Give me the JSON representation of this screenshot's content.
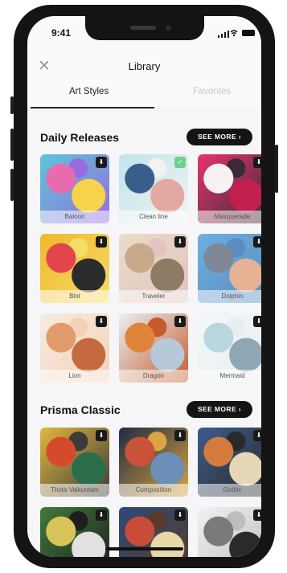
{
  "status": {
    "time": "9:41"
  },
  "header": {
    "title": "Library",
    "close_icon": "close-icon"
  },
  "tabs": [
    {
      "label": "Art Styles",
      "active": true
    },
    {
      "label": "Favorites",
      "active": false
    }
  ],
  "sections": [
    {
      "title": "Daily Releases",
      "see_more": "SEE MORE",
      "items": [
        {
          "label": "Baloon",
          "badge": "download",
          "colors": [
            "#59c7d6",
            "#e86bb0",
            "#f7d24b",
            "#9a6be0"
          ]
        },
        {
          "label": "Clean line",
          "badge": "check",
          "colors": [
            "#bfe5ea",
            "#3a5e8a",
            "#e4a8a2",
            "#f2f2f2"
          ]
        },
        {
          "label": "Masquerade",
          "badge": "download",
          "colors": [
            "#e7356c",
            "#f8f1f3",
            "#c11f4e",
            "#3a2a3a"
          ]
        },
        {
          "label": "Blot",
          "badge": "download",
          "colors": [
            "#f0b72d",
            "#e2454b",
            "#2b2b2b",
            "#f4dd68"
          ]
        },
        {
          "label": "Traveler",
          "badge": "download",
          "colors": [
            "#e8dcc9",
            "#c8a98a",
            "#8f7a66",
            "#e3c4c0"
          ]
        },
        {
          "label": "Dolphin",
          "badge": "download",
          "colors": [
            "#6cb0dc",
            "#7e8896",
            "#e5b393",
            "#5b8dc2"
          ]
        },
        {
          "label": "Lion",
          "badge": "download",
          "colors": [
            "#f6ebe2",
            "#e39a6c",
            "#c56a3f",
            "#f3d2b8"
          ]
        },
        {
          "label": "Dragon",
          "badge": "download",
          "colors": [
            "#e8f0f6",
            "#e0843a",
            "#b7c9d8",
            "#c65b2c"
          ]
        },
        {
          "label": "Mermaid",
          "badge": "download",
          "colors": [
            "#f3f7f8",
            "#b8d6dc",
            "#8fa7b5",
            "#e7eef0"
          ]
        }
      ]
    },
    {
      "title": "Prisma Classic",
      "see_more": "SEE MORE",
      "items": [
        {
          "label": "Thota Vaikuntam",
          "badge": "download",
          "colors": [
            "#e2b73c",
            "#d64a2c",
            "#2b6d4b",
            "#3b3b3b"
          ]
        },
        {
          "label": "Composition",
          "badge": "download",
          "colors": [
            "#1f2a44",
            "#c8523a",
            "#6b8fb6",
            "#d9a441"
          ]
        },
        {
          "label": "Gothic",
          "badge": "download",
          "colors": [
            "#3d5c8c",
            "#d47a3d",
            "#e6d7b8",
            "#2a2a2a"
          ]
        },
        {
          "label": "",
          "badge": "download",
          "colors": [
            "#3f7b3a",
            "#d9c45a",
            "#e2e2e2",
            "#1e1e1e"
          ]
        },
        {
          "label": "",
          "badge": "download",
          "colors": [
            "#2b4a7a",
            "#c94b3a",
            "#e8d7a7",
            "#5a3a2a"
          ]
        },
        {
          "label": "",
          "badge": "download",
          "colors": [
            "#f2f2f2",
            "#7a7a7a",
            "#2a2a2a",
            "#bdbdbd"
          ]
        }
      ]
    }
  ]
}
